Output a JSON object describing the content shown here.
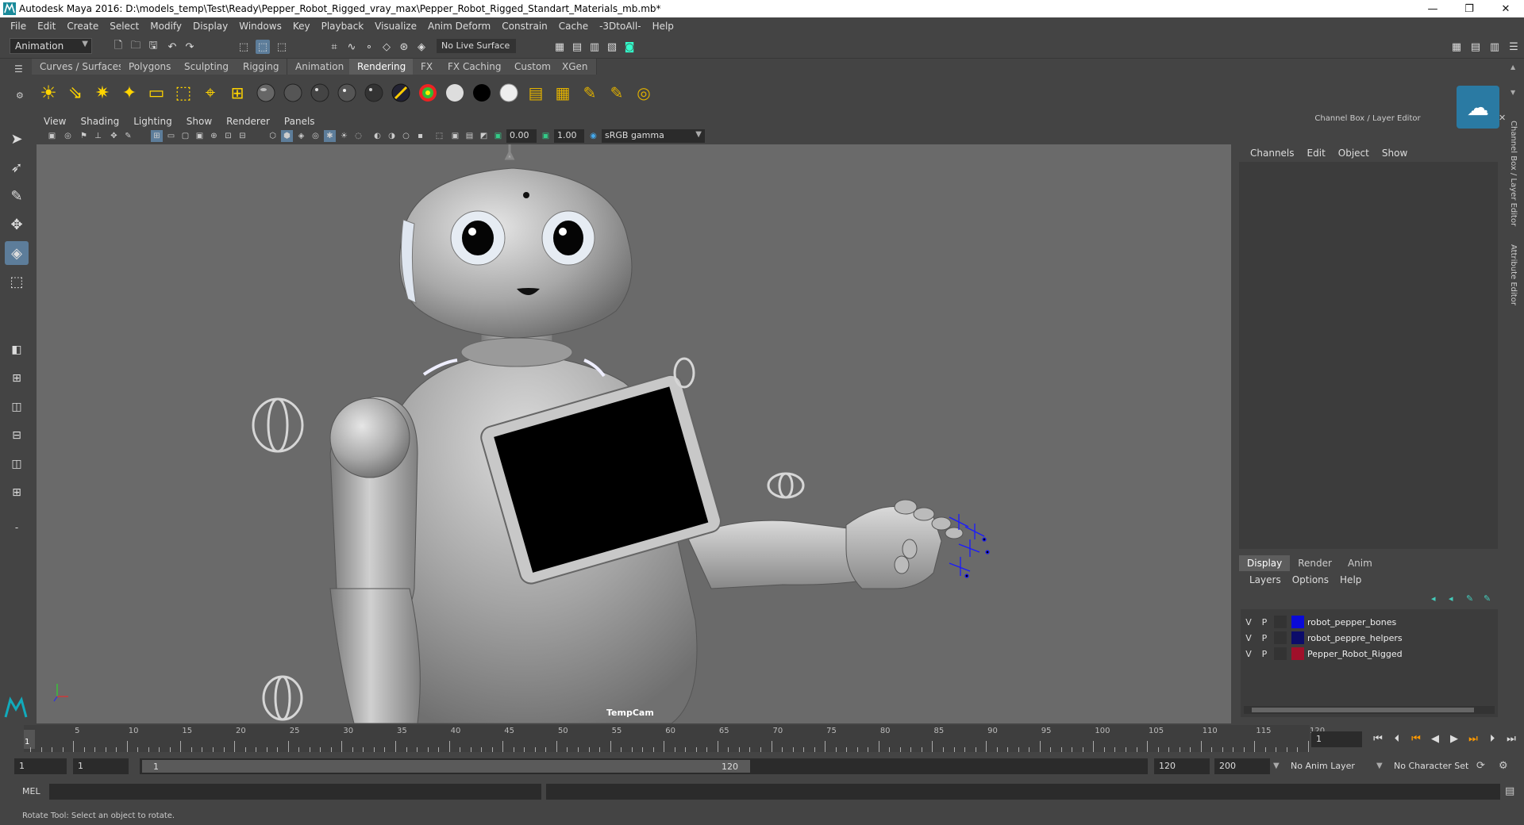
{
  "window": {
    "title": "Autodesk Maya 2016: D:\\models_temp\\Test\\Ready\\Pepper_Robot_Rigged_vray_max\\Pepper_Robot_Rigged_Standart_Materials_mb.mb*",
    "minimize": "—",
    "restore": "❐",
    "close": "✕"
  },
  "menubar": [
    "File",
    "Edit",
    "Create",
    "Select",
    "Modify",
    "Display",
    "Windows",
    "Key",
    "Playback",
    "Visualize",
    "Anim Deform",
    "Constrain",
    "Cache",
    "-3DtoAll-",
    "Help"
  ],
  "statusline": {
    "mode": "Animation",
    "live_surface": "No Live Surface"
  },
  "shelf_tabs": [
    "Curves / Surfaces",
    "Polygons",
    "Sculpting",
    "Rigging",
    "Animation",
    "Rendering",
    "FX",
    "FX Caching",
    "Custom",
    "XGen"
  ],
  "active_shelf_tab": "Rendering",
  "viewport": {
    "menus": [
      "View",
      "Shading",
      "Lighting",
      "Show",
      "Renderer",
      "Panels"
    ],
    "exposure": "0.00",
    "gamma": "1.00",
    "color_space": "sRGB gamma",
    "camera_label": "TempCam"
  },
  "channel_box": {
    "title": "Channel Box / Layer Editor",
    "menus": [
      "Channels",
      "Edit",
      "Object",
      "Show"
    ]
  },
  "layer_editor": {
    "tabs": [
      "Display",
      "Render",
      "Anim"
    ],
    "active_tab": "Display",
    "menus": [
      "Layers",
      "Options",
      "Help"
    ],
    "layers": [
      {
        "v": "V",
        "p": "P",
        "name": "robot_pepper_bones",
        "color": "#0a0ad8"
      },
      {
        "v": "V",
        "p": "P",
        "name": "robot_peppre_helpers",
        "color": "#0c0c6a"
      },
      {
        "v": "V",
        "p": "P",
        "name": "Pepper_Robot_Rigged",
        "color": "#a0102a"
      }
    ]
  },
  "side_tabs": [
    "Channel Box / Layer Editor",
    "Attribute Editor"
  ],
  "timeline": {
    "ticks": [
      "5",
      "10",
      "15",
      "20",
      "25",
      "30",
      "35",
      "40",
      "45",
      "50",
      "55",
      "60",
      "65",
      "70",
      "75",
      "80",
      "85",
      "90",
      "95",
      "100",
      "105",
      "110",
      "115",
      "120"
    ],
    "current_frame": "1",
    "current_frame_field": "1"
  },
  "range": {
    "start": "1",
    "playback_start": "1",
    "handle_start": "1",
    "handle_end": "120",
    "playback_end": "120",
    "end": "200",
    "anim_layer": "No Anim Layer",
    "character_set": "No Character Set"
  },
  "command": {
    "label": "MEL",
    "help": "Rotate Tool: Select an object to rotate."
  }
}
